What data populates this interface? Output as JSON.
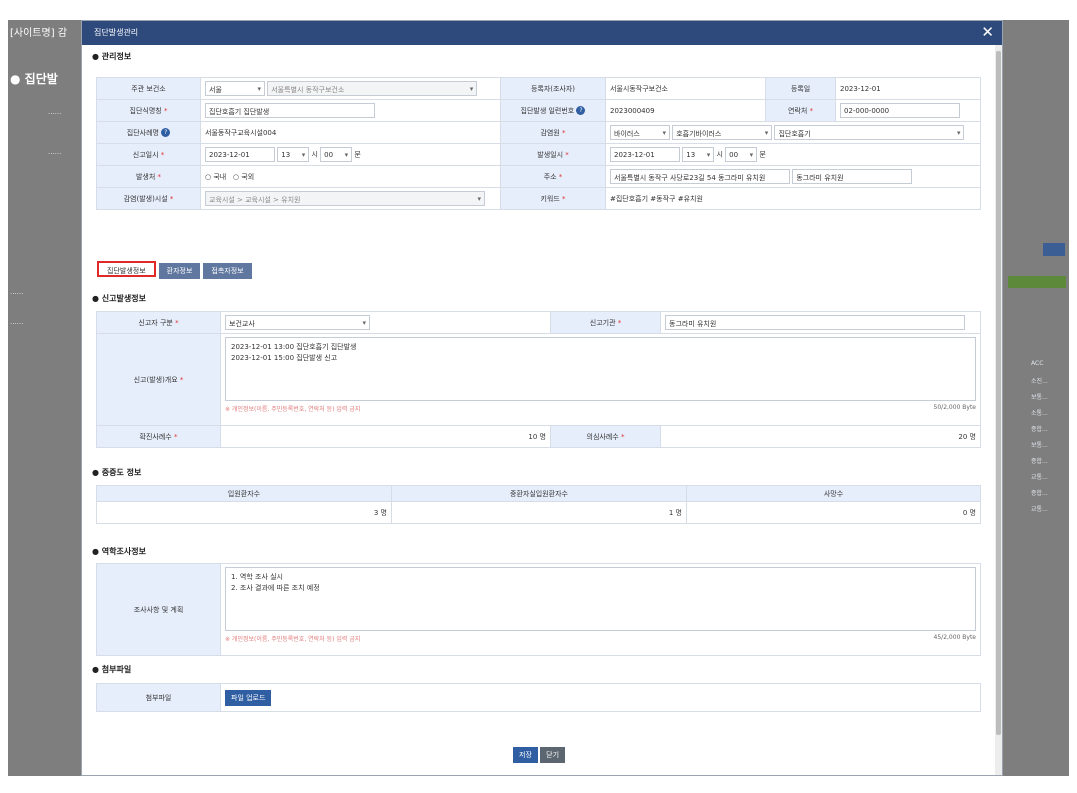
{
  "background_page": {
    "title": "[사이트명] 감",
    "heading": "● 집단발",
    "right_labels": [
      "ACC",
      "소진...",
      "보통...",
      "소통...",
      "종합...",
      "보통...",
      "종합...",
      "교통...",
      "종합...",
      "교통..."
    ]
  },
  "modal": {
    "title": "집단발생관리",
    "close_label": "✕"
  },
  "management": {
    "section_title": "● 관리정보",
    "rows": [
      {
        "l1": "주관 보건소",
        "v1a": "서울",
        "v1b": "서울특별시 동작구보건소",
        "l2": "등록자(조사자)",
        "v2": "서울시동작구보건소",
        "l3": "등록일",
        "v3": "2023-12-01"
      },
      {
        "l1": "집단식명칭",
        "v1a": "집단호흡기 집단발생",
        "l2": "집단발생 일련번호",
        "v2": "2023000409",
        "l3": "연락처",
        "v3": "02-000-0000"
      },
      {
        "l1": "집단사례명",
        "v1a": "서울동작구교육시설004",
        "l2": "감염원",
        "v2a": "바이러스",
        "v2b": "호흡기바이러스",
        "v2c": "집단호흡기"
      },
      {
        "l1": "신고일시",
        "v1a": "2023-12-01",
        "v1b": "13",
        "v1c": "00",
        "l2": "발생일시",
        "v2a": "2023-12-01",
        "v2b": "13",
        "v2c": "00"
      },
      {
        "l1": "발생처",
        "v1a": "국내",
        "v1b": "국외",
        "l2": "주소",
        "v2a": "서울특별시 동작구 사당로23길 54 동그라미 유치원",
        "v2b": "동그라미 유치원"
      },
      {
        "l1": "감염(발생)시설",
        "v1a": "교육시설 > 교육시설 > 유치원",
        "l2": "키워드",
        "v2": "#집단호흡기 #동작구 #유치원"
      }
    ]
  },
  "tabs": [
    "집단발생정보",
    "환자정보",
    "접촉자정보"
  ],
  "report": {
    "section_title": "● 신고발생정보",
    "reporter_type_label": "신고자 구분",
    "reporter_type_value": "보건교사",
    "agency_label": "신고기관",
    "agency_value": "동그라미 유치원",
    "details_label": "신고(발생)개요",
    "details_lines": [
      "2023-12-01 13:00 집단호흡기 집단발생",
      "2023-12-01 15:00 집단발생 신고"
    ],
    "details_hint": "※ 개인정보(이름, 주민등록번호, 연락처 등) 입력 금지",
    "details_bytes": "50/2,000 Byte",
    "confirmed_label": "확진사례수",
    "confirmed_value": "10",
    "suspected_label": "의심사례수",
    "suspected_value": "20",
    "unit": "명"
  },
  "severity": {
    "section_title": "● 중증도 정보",
    "headers": [
      "입원환자수",
      "중환자실입원환자수",
      "사망수"
    ],
    "values": [
      "3",
      "1",
      "0"
    ],
    "unit": "명"
  },
  "epi": {
    "section_title": "● 역학조사정보",
    "label": "조사사항 및 계획",
    "lines": [
      "1. 역학 조사 실시",
      "2. 조사 결과에 따른 조치 예정"
    ],
    "hint": "※ 개인정보(이름, 주민등록번호, 연락처 등) 입력 금지",
    "bytes": "45/2,000 Byte"
  },
  "attach": {
    "section_title": "● 첨부파일",
    "label": "첨부파일",
    "button": "파일 업로드"
  },
  "footer": {
    "save": "저장",
    "close": "닫기"
  }
}
